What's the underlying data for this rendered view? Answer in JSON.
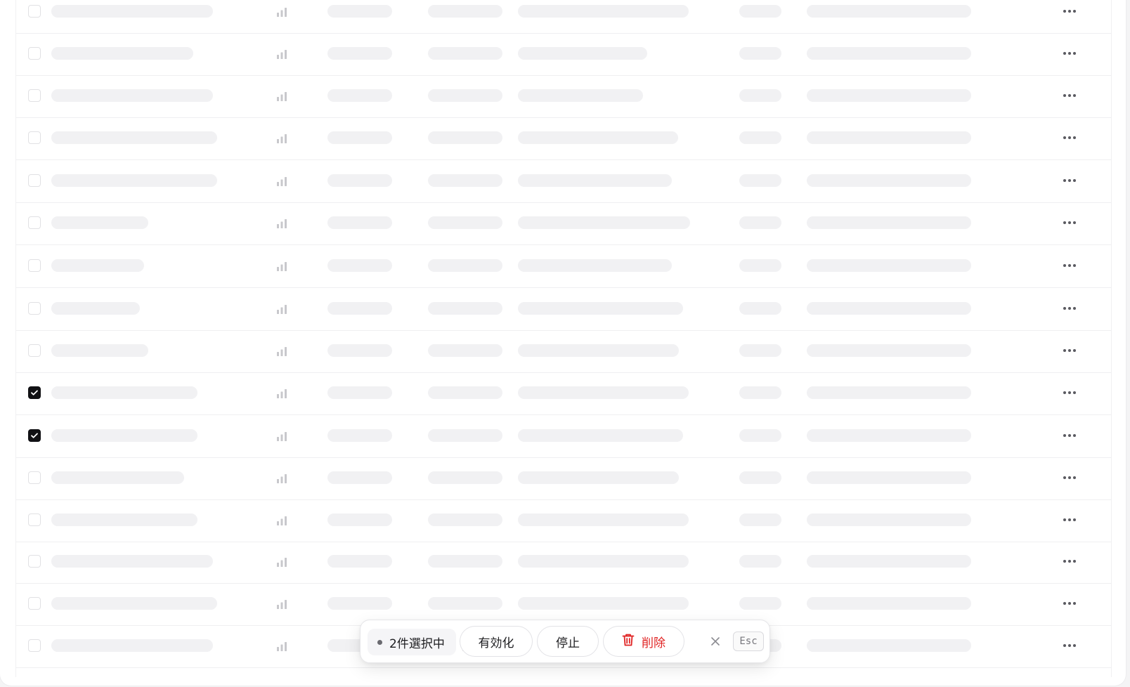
{
  "table": {
    "row_count": 16,
    "selected_rows": [
      9,
      10
    ],
    "row_action_icon": "more-horizontal-icon",
    "metric_icon": "bar-chart-icon"
  },
  "bulk_bar": {
    "selection_label": "2件選択中",
    "enable_label": "有効化",
    "stop_label": "停止",
    "delete_label": "削除",
    "delete_icon": "trash-icon",
    "close_icon": "close-icon",
    "esc_hint": "Esc"
  },
  "colors": {
    "skeleton": "#f1f1f3",
    "checked": "#111114",
    "danger": "#e02424"
  }
}
